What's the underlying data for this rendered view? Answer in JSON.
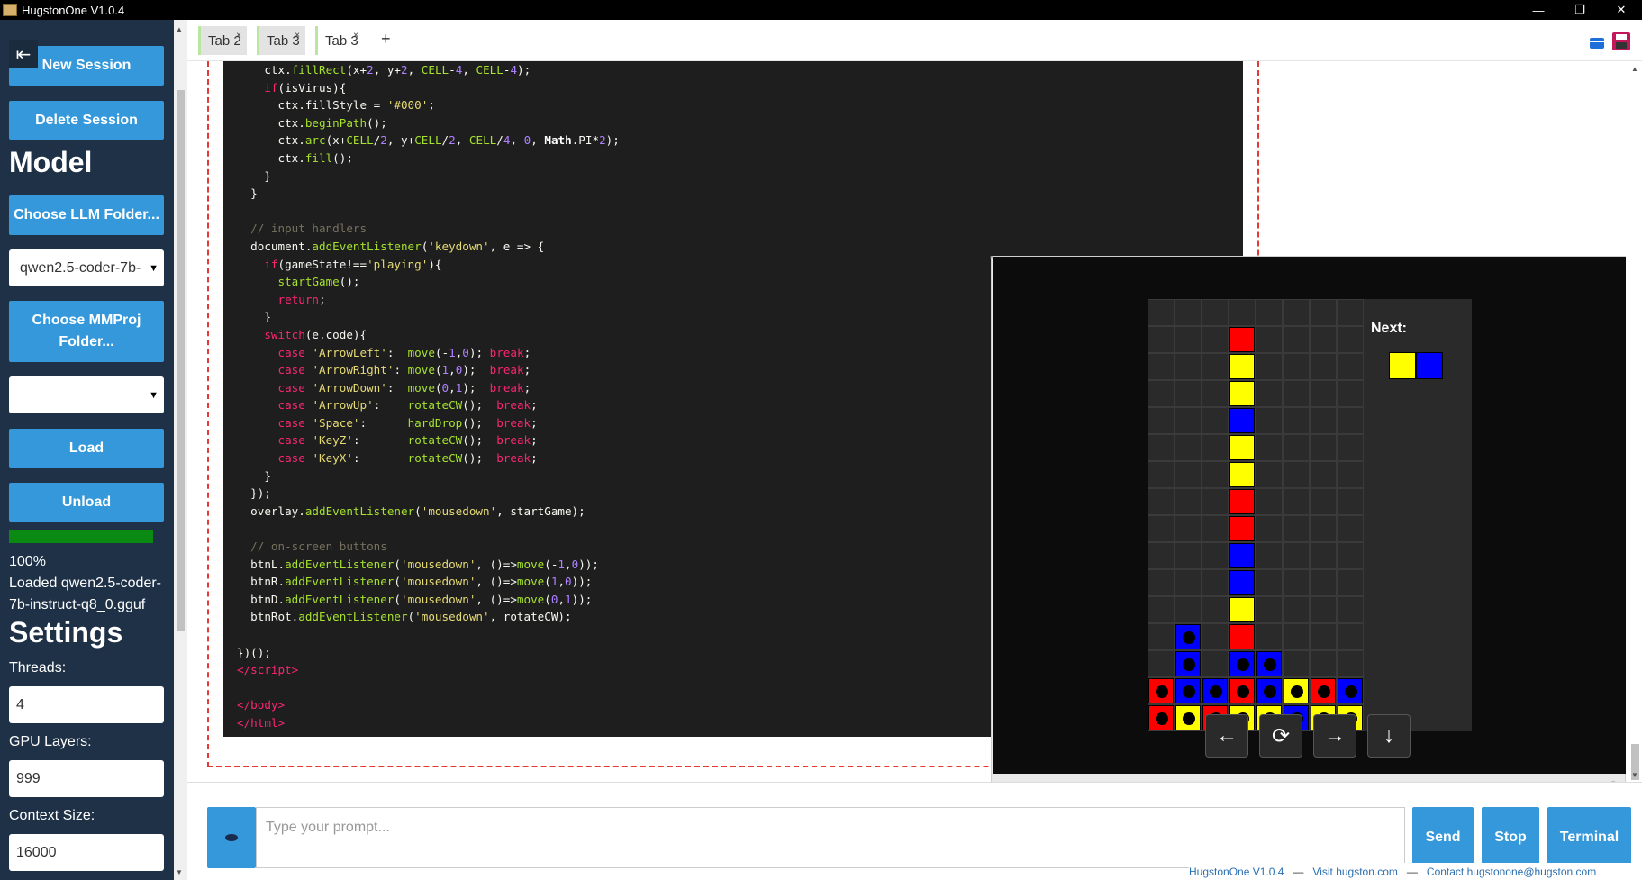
{
  "window": {
    "title": "HugstonOne V1.0.4",
    "minimize": "—",
    "maximize": "❐",
    "close": "✕"
  },
  "sidebar": {
    "collapse_icon": "⇤",
    "new_session": "New Session",
    "delete_session": "Delete Session",
    "model_heading": "Model",
    "choose_llm": "Choose LLM Folder...",
    "llm_selected": "qwen2.5-coder-7b-",
    "choose_mmproj": "Choose MMProj Folder...",
    "mmproj_selected": "",
    "load": "Load",
    "unload": "Unload",
    "progress_percent": "100%",
    "progress_value": 1.0,
    "status_line1": "Loaded qwen2.5-coder-",
    "status_line2": "7b-instruct-q8_0.gguf",
    "settings_heading": "Settings",
    "threads_label": "Threads:",
    "threads_value": "4",
    "gpu_label": "GPU Layers:",
    "gpu_value": "999",
    "context_label": "Context Size:",
    "context_value": "16000"
  },
  "tabs": [
    {
      "label": "Tab 2",
      "close": "×"
    },
    {
      "label": "Tab 3",
      "close": "×"
    },
    {
      "label": "Tab 3",
      "close": "×"
    }
  ],
  "tab_add": "+",
  "toolbar_icons": [
    "card-icon",
    "save-icon"
  ],
  "game": {
    "next_label": "Next:",
    "next_colors": [
      "#ffff00",
      "#0000ff"
    ],
    "buttons": {
      "left": "←",
      "rotate": "⟳",
      "right": "→",
      "down": "↓"
    },
    "window_controls": {
      "minimize": "–",
      "maximize": "▢",
      "pin": "⇓"
    },
    "colors": {
      "red": "#ff0000",
      "yellow": "#ffff00",
      "blue": "#0000ff"
    }
  },
  "prompt": {
    "placeholder": "Type your prompt...",
    "send": "Send",
    "stop": "Stop",
    "terminal": "Terminal"
  },
  "footer": {
    "version": "HugstonOne V1.0.4",
    "sep": "—",
    "visit": "Visit hugston.com",
    "contact": "Contact hugstonone@hugston.com"
  }
}
